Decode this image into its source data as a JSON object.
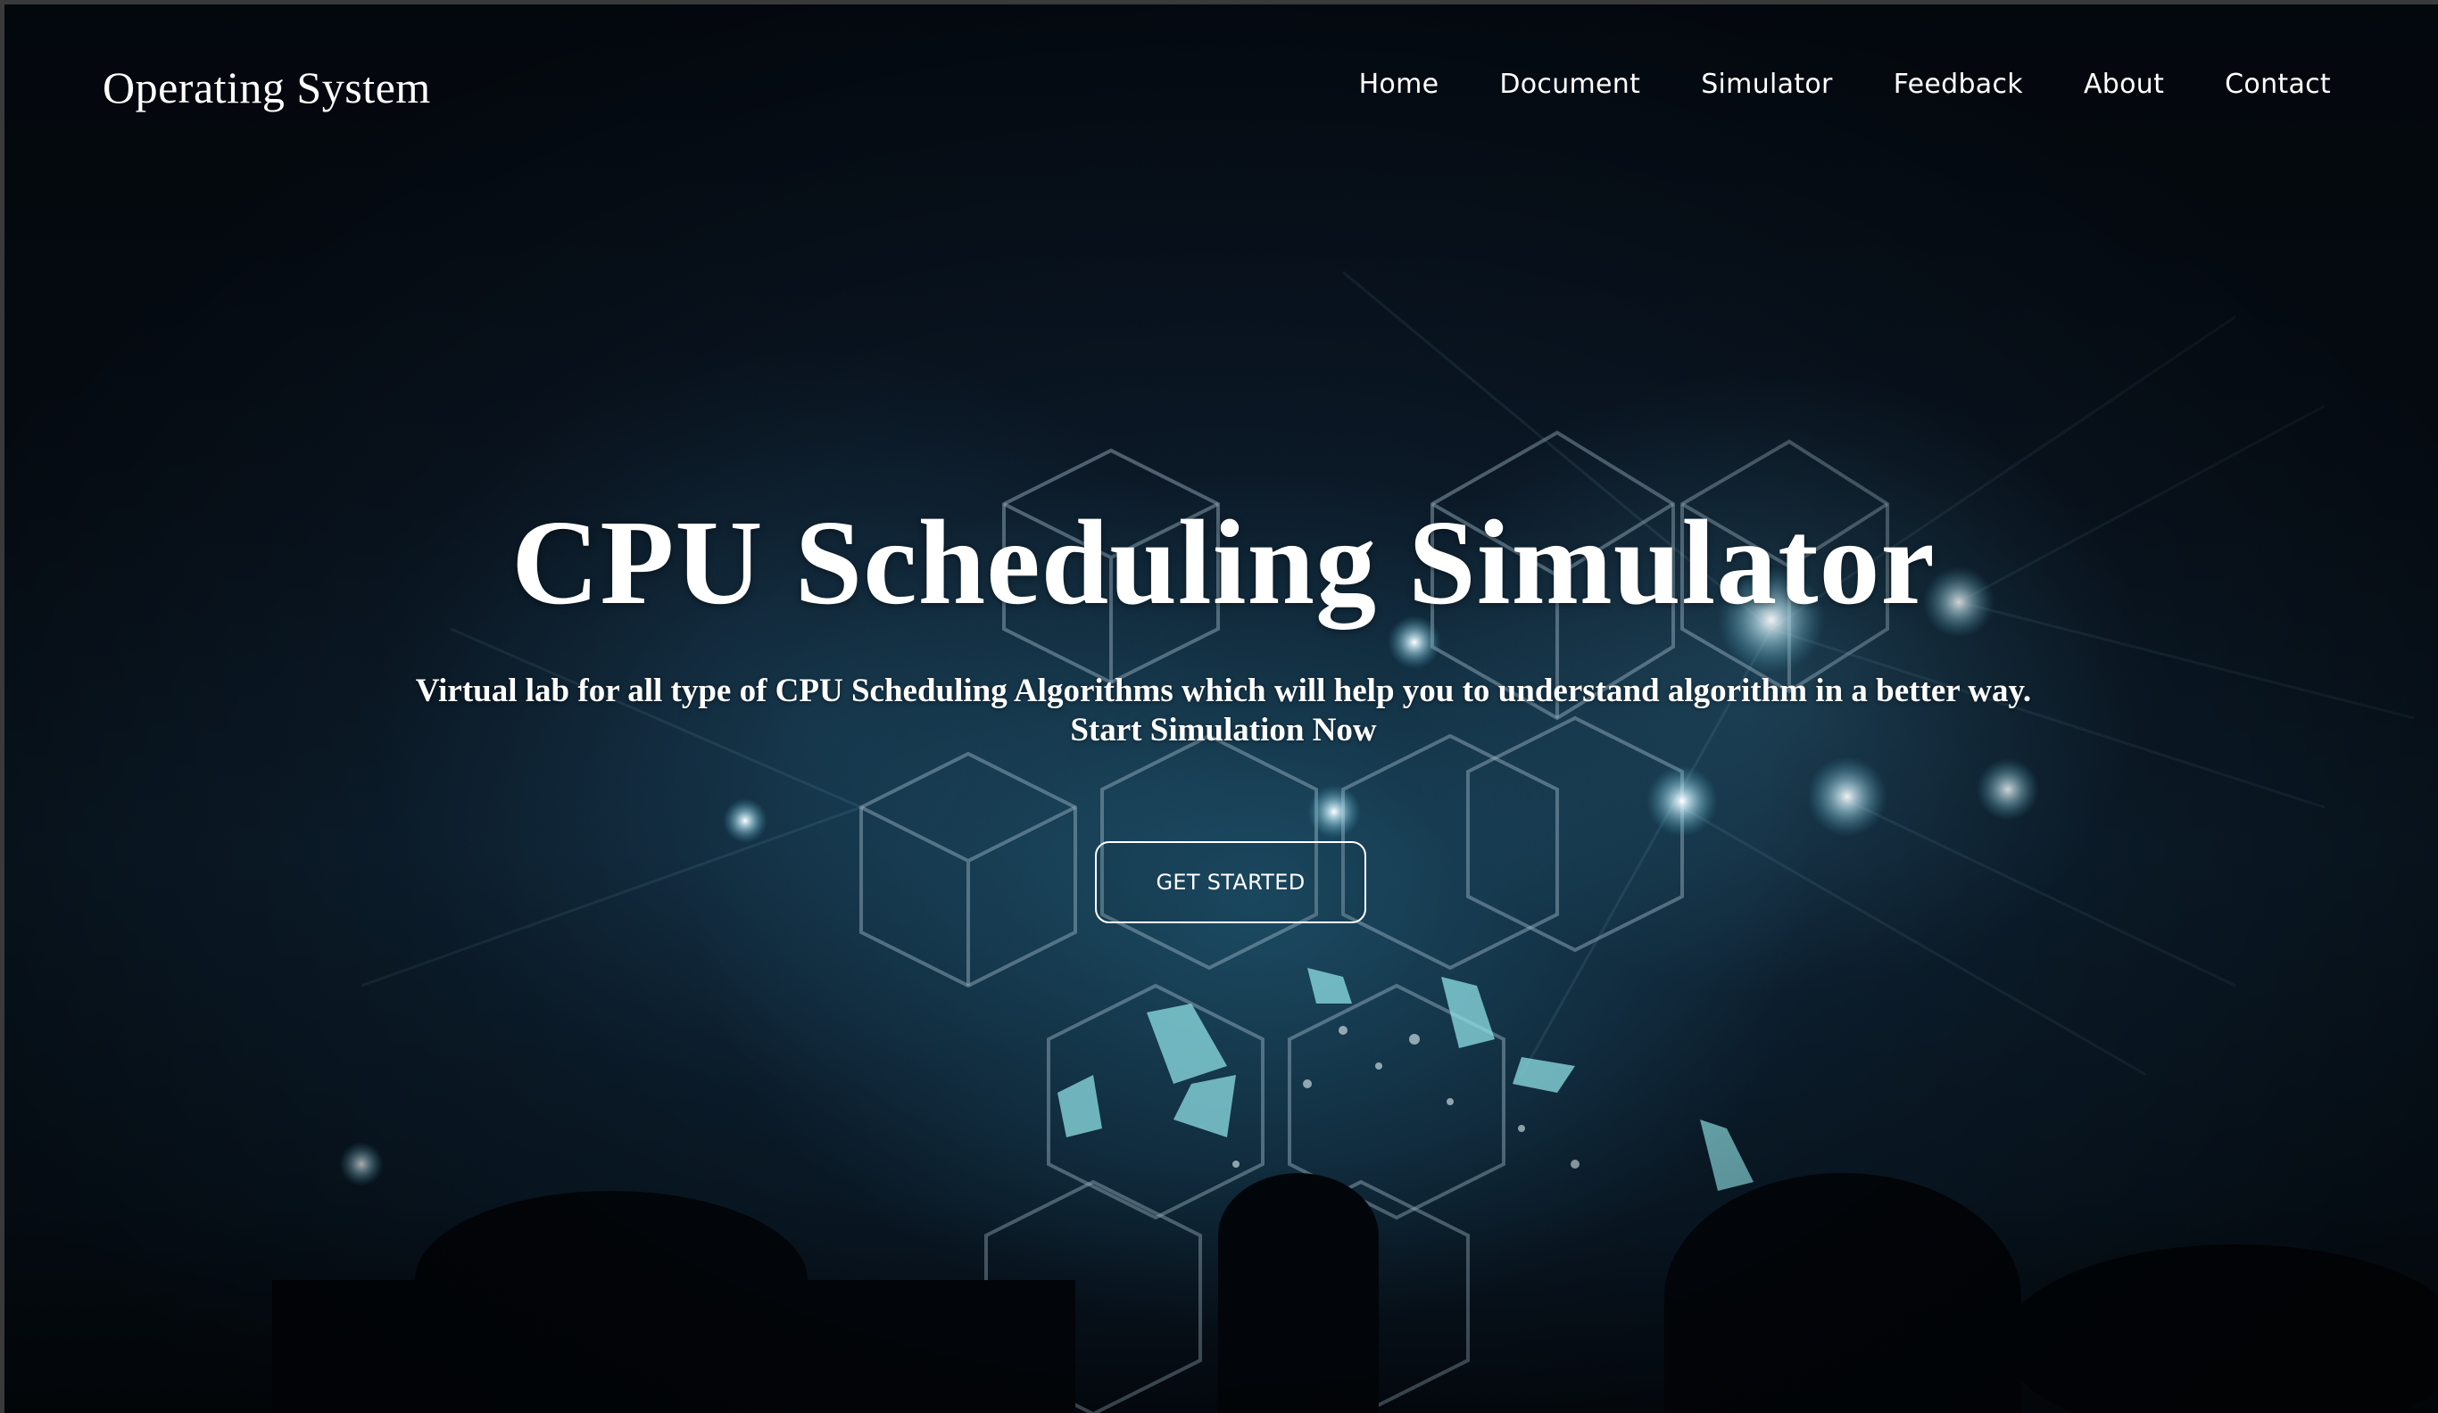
{
  "header": {
    "brand": "Operating System",
    "nav": [
      {
        "label": "Home"
      },
      {
        "label": "Document"
      },
      {
        "label": "Simulator"
      },
      {
        "label": "Feedback"
      },
      {
        "label": "About"
      },
      {
        "label": "Contact"
      }
    ]
  },
  "hero": {
    "title": "CPU Scheduling Simulator",
    "subtitle_line1": "Virtual lab for all type of CPU Scheduling Algorithms which will help you to understand algorithm in a better way.",
    "subtitle_line2": "Start Simulation Now",
    "cta_label": "GET STARTED"
  },
  "colors": {
    "text": "#ffffff",
    "background": "#06101c",
    "accent_glow": "#3c9ab4"
  }
}
